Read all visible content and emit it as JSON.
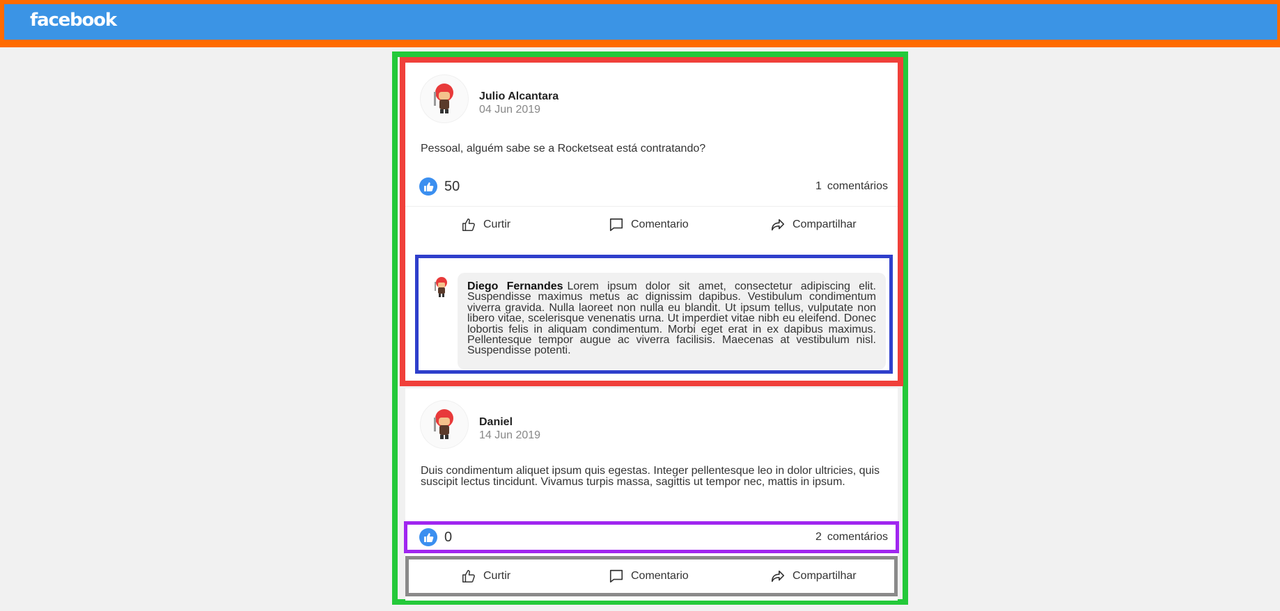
{
  "header": {
    "logo_text": "facebook",
    "bg_color": "#3b94e5",
    "frame_color": "#ff6b00"
  },
  "posts": [
    {
      "author": "Julio Alcantara",
      "date": "04 Jun 2019",
      "content": "Pessoal, alguém sabe se a Rocketseat está contratando?",
      "likes": "50",
      "comments_count": "1",
      "comments_label": "comentários",
      "actions": {
        "like": "Curtir",
        "comment": "Comentario",
        "share": "Compartilhar"
      },
      "comments": [
        {
          "author": "Diego Fernandes",
          "content": "Lorem ipsum dolor sit amet, consectetur adipiscing elit. Suspendisse maximus metus ac dignissim dapibus. Vestibulum condimentum viverra gravida. Nulla laoreet non nulla eu blandit. Ut ipsum tellus, vulputate non libero vitae, scelerisque venenatis urna. Ut imperdiet vitae nibh eu eleifend. Donec lobortis felis in aliquam condimentum. Morbi eget erat in ex dapibus maximus. Pellentesque tempor augue ac viverra facilisis. Maecenas at vestibulum nisl. Suspendisse potenti."
        }
      ]
    },
    {
      "author": "Daniel",
      "date": "14 Jun 2019",
      "content": "Duis condimentum aliquet ipsum quis egestas. Integer pellentesque leo in dolor ultricies, quis suscipit lectus tincidunt. Vivamus turpis massa, sagittis ut tempor nec, mattis in ipsum.",
      "likes": "0",
      "comments_count": "2",
      "comments_label": "comentários",
      "actions": {
        "like": "Curtir",
        "comment": "Comentario",
        "share": "Compartilhar"
      }
    }
  ],
  "colors": {
    "like_badge": "#3b8ff0",
    "feed_frame": "#24c93a",
    "post_frame": "#f0403a",
    "comment_frame": "#2f3fcb"
  },
  "icons": {
    "like_badge": "thumbs-up-icon",
    "like_action": "thumbs-up-outline-icon",
    "comment_action": "speech-bubble-icon",
    "share_action": "share-arrow-icon",
    "avatar": "avatar-character"
  }
}
